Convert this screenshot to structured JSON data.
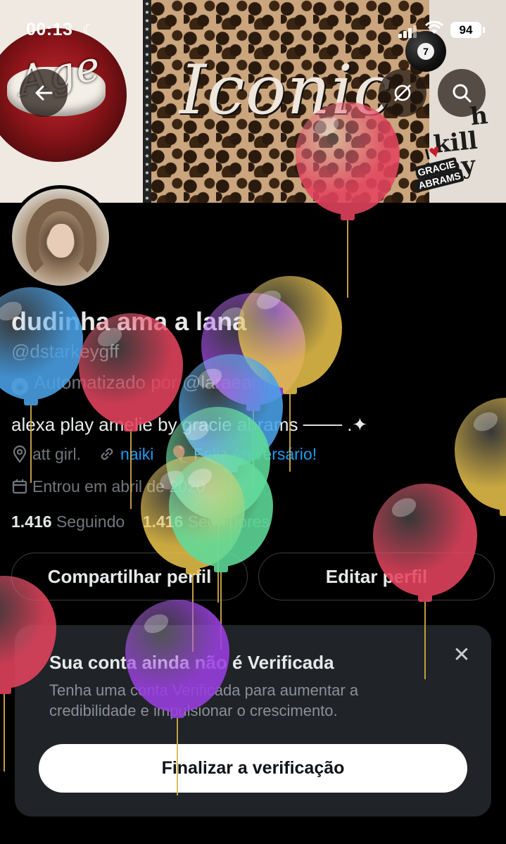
{
  "status_bar": {
    "time": "00:13",
    "battery": "94"
  },
  "banner": {
    "lips_text": "Age",
    "center_text": "Iconic",
    "right_text_line1": "h",
    "right_text_line2": "kill my",
    "sticker_line1": "I",
    "sticker_line2": "GRACIE",
    "sticker_line3": "ABRAMS",
    "eightball_number": "7"
  },
  "profile": {
    "display_name": "dudinha ama a lana",
    "handle": "@dstarkeygff",
    "automated_label": "Automatizado por @laraeamb",
    "bio": "alexa play amelie by gracie abrams ─── .✦",
    "location": "att girl.",
    "link": "naiki",
    "birthday_text": "Feliz Aniversário!",
    "joined": "Entrou em abril de 2020",
    "following_count": "1.416",
    "following_label": "Seguindo",
    "followers_count": "1.416",
    "followers_label": "Seguidores"
  },
  "actions": {
    "share_label": "Compartilhar perfil",
    "edit_label": "Editar perfil"
  },
  "verification": {
    "title": "Sua conta ainda não é Verificada",
    "body": "Tenha uma conta Verificada para aumentar a credibilidade e impulsionar o crescimento.",
    "button_label": "Finalizar a verificação",
    "close_icon": "close-icon"
  },
  "colors": {
    "background": "#000000",
    "link_blue": "#1d9bf0",
    "muted": "#71767b",
    "card": "#202327",
    "balloon_red": "#e4445e",
    "balloon_yellow": "#e6c04a",
    "balloon_purple": "#9a3fe0",
    "balloon_blue": "#4aa2e8",
    "balloon_green": "#5fdc9a"
  },
  "icons": {
    "back": "arrow-left-icon",
    "grok": "grok-icon",
    "search": "search-icon",
    "location": "location-pin-icon",
    "link": "link-icon",
    "calendar": "calendar-icon",
    "balloon": "balloon-icon"
  }
}
